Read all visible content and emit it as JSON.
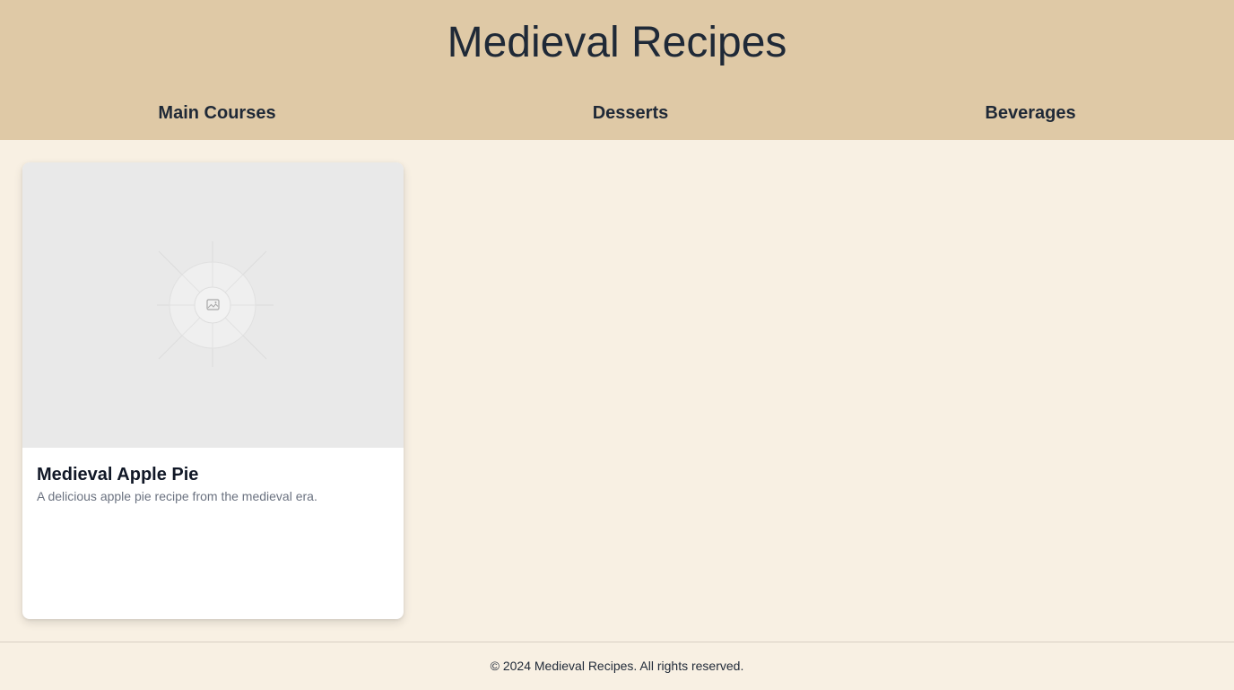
{
  "header": {
    "title": "Medieval Recipes",
    "nav": [
      {
        "label": "Main Courses"
      },
      {
        "label": "Desserts"
      },
      {
        "label": "Beverages"
      }
    ]
  },
  "recipes": [
    {
      "title": "Medieval Apple Pie",
      "description": "A delicious apple pie recipe from the medieval era.",
      "image_icon": "image-placeholder-icon"
    }
  ],
  "footer": {
    "text": "© 2024 Medieval Recipes. All rights reserved."
  },
  "colors": {
    "header_bg": "#dfc9a6",
    "page_bg": "#f8f0e3",
    "card_bg": "#ffffff",
    "image_placeholder_bg": "#e9e9e9"
  }
}
